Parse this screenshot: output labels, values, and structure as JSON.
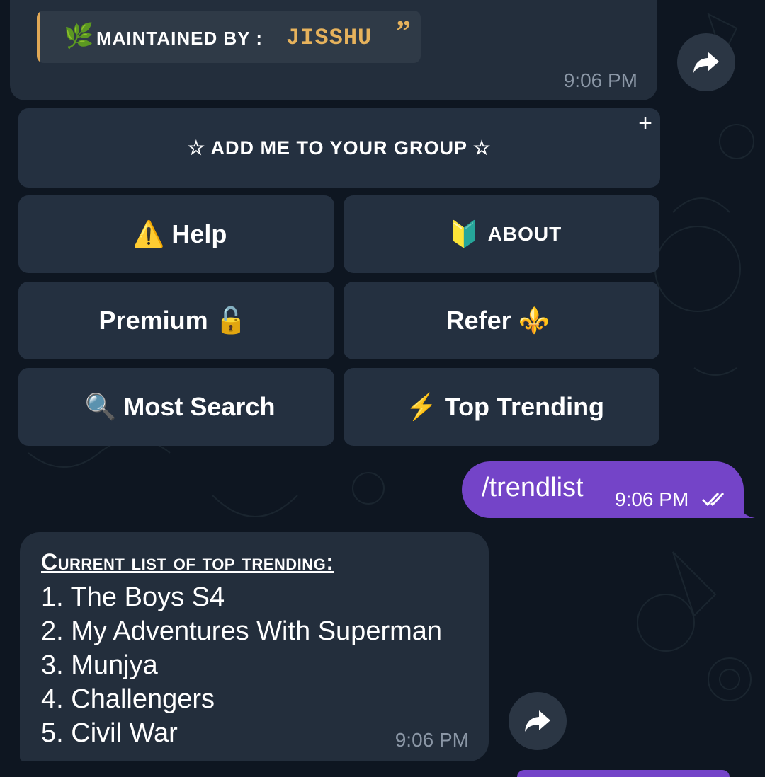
{
  "top_message": {
    "maintained_label": "MAINTAINED BY :",
    "maintainer": "JISSHU",
    "quote_mark": "”",
    "leaf_icon": "🌿",
    "time": "9:06 PM"
  },
  "keyboard": {
    "add_group": "☆ ADD ME TO YOUR GROUP ☆",
    "add_group_plus": "+",
    "help": {
      "emoji": "⚠️",
      "label": "Help"
    },
    "about": {
      "emoji": "🔰",
      "label": "ABOUT"
    },
    "premium": {
      "emoji": "🔓",
      "label": "Premium"
    },
    "refer": {
      "emoji": "⚜️",
      "label": "Refer"
    },
    "most_search": {
      "emoji": "🔍",
      "label": "Most Search"
    },
    "top_trending": {
      "emoji": "⚡",
      "label": "Top Trending"
    }
  },
  "outgoing": {
    "text": "/trendlist",
    "time": "9:06 PM"
  },
  "trend_list": {
    "heading": "Current list of top trending:",
    "items": [
      "1. The Boys S4",
      "2. My Adventures With Superman",
      "3. Munjya",
      "4. Challengers",
      "5. Civil War"
    ],
    "time": "9:06 PM"
  },
  "colors": {
    "background": "#0e1621",
    "bubble_in": "#232e3c",
    "bubble_out": "#7444c8",
    "button": "#243040",
    "accent_gold": "#e6b25c"
  }
}
